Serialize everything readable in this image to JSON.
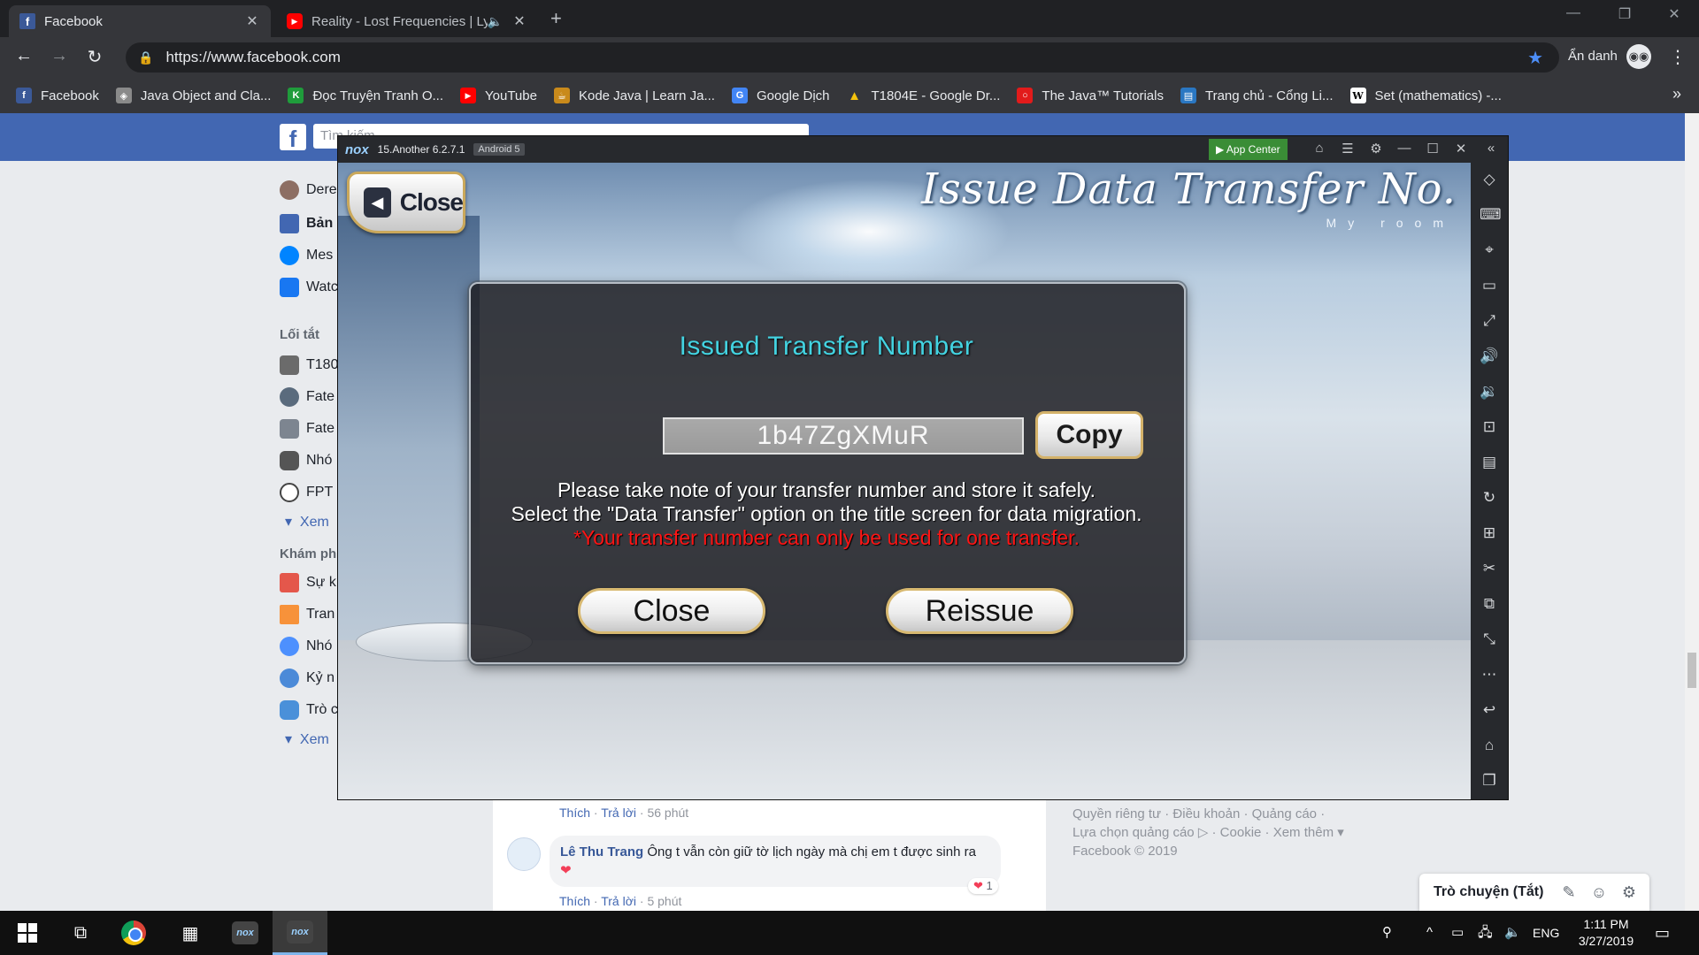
{
  "browser": {
    "tabs": [
      {
        "title": "Facebook",
        "favicon": "facebook-icon",
        "active": true
      },
      {
        "title": "Reality - Lost Frequencies | Ly",
        "favicon": "youtube-icon",
        "active": false
      }
    ],
    "new_tab_label": "+",
    "address": "https://www.facebook.com",
    "incognito_label": "Ẩn danh",
    "bookmarks": [
      {
        "label": "Facebook",
        "icon": "facebook-icon",
        "color": "#3b5998"
      },
      {
        "label": "Java Object and Cla...",
        "icon": "cube-icon",
        "color": "#8a8a8a"
      },
      {
        "label": "Đọc Truyện Tranh O...",
        "icon": "k-icon",
        "color": "#1f9c3b"
      },
      {
        "label": "YouTube",
        "icon": "youtube-icon",
        "color": "#ff0000"
      },
      {
        "label": "Kode Java | Learn Ja...",
        "icon": "coffee-icon",
        "color": "#c98a1b"
      },
      {
        "label": "Google Dịch",
        "icon": "translate-icon",
        "color": "#4285f4"
      },
      {
        "label": "T1804E - Google Dr...",
        "icon": "drive-icon",
        "color": "#0f9d58"
      },
      {
        "label": "The Java™ Tutorials",
        "icon": "oracle-icon",
        "color": "#e21b1b"
      },
      {
        "label": "Trang chủ - Cổng Li...",
        "icon": "portal-icon",
        "color": "#2a77c2"
      },
      {
        "label": "Set (mathematics) -...",
        "icon": "wikipedia-icon",
        "color": "#ffffff"
      }
    ]
  },
  "facebook": {
    "search_placeholder": "Tìm kiếm",
    "nav": [
      {
        "label": "Dere",
        "icon": "profile-avatar-icon",
        "color": "#8d6e63"
      },
      {
        "label": "Bản",
        "icon": "news-feed-icon",
        "color": "#4267b2"
      },
      {
        "label": "Mes",
        "icon": "messenger-icon",
        "color": "#0084ff"
      },
      {
        "label": "Watc",
        "icon": "watch-icon",
        "color": "#1877f2"
      }
    ],
    "shortcuts_heading": "Lối tắt",
    "shortcuts": [
      {
        "label": "T180",
        "icon": "group-icon",
        "color": "#6b6b6b"
      },
      {
        "label": "Fate",
        "icon": "shield-icon",
        "color": "#5a6b7d"
      },
      {
        "label": "Fate",
        "icon": "group-icon",
        "color": "#7d8590"
      },
      {
        "label": "Nhó",
        "icon": "gamepad-icon",
        "color": "#555"
      },
      {
        "label": "FPT",
        "icon": "skull-icon",
        "color": "#444"
      }
    ],
    "see_more_1": "Xem",
    "explore_heading": "Khám ph",
    "explore": [
      {
        "label": "Sự k",
        "icon": "calendar-icon",
        "color": "#e4574b"
      },
      {
        "label": "Tran",
        "icon": "flag-icon",
        "color": "#f7923a"
      },
      {
        "label": "Nhó",
        "icon": "groups-icon",
        "color": "#4d90fe"
      },
      {
        "label": "Kỷ n",
        "icon": "memories-icon",
        "color": "#4b8ad8"
      },
      {
        "label": "Trò c",
        "icon": "gaming-icon",
        "color": "#4a90d9"
      }
    ],
    "see_more_2": "Xem",
    "comments": {
      "meta1": {
        "like": "Thích",
        "reply": "Trả lời",
        "time": "56 phút"
      },
      "author": "Lê Thu Trang",
      "text": "Ông t vẫn còn giữ tờ lịch ngày mà chị em t được sinh ra",
      "reaction_count": "1",
      "meta2": {
        "like": "Thích",
        "reply": "Trả lời",
        "time": "5 phút"
      }
    },
    "footer": {
      "line1": "Quyền riêng tư · Điều khoản · Quảng cáo ·",
      "line2": "Lựa chọn quảng cáo ▷ · Cookie · Xem thêm ▾",
      "line3": "Facebook © 2019"
    },
    "chat_label": "Trò chuyện (Tắt)"
  },
  "nox": {
    "logo": "nox",
    "version": "15.Another 6.2.7.1",
    "android": "Android 5",
    "app_center": "App Center",
    "side_icons": [
      "tag-icon",
      "keyboard-icon",
      "location-icon",
      "screen-icon",
      "fullscreen-icon",
      "volume-up-icon",
      "volume-down-icon",
      "screenshot-icon",
      "apk-icon",
      "rotate-icon",
      "add-icon",
      "scissors-icon",
      "multi-instance-icon",
      "resize-icon",
      "more-icon",
      "back-icon",
      "home-icon",
      "recent-apps-icon"
    ]
  },
  "game": {
    "top_close": "Close",
    "screen_title": "Issue Data Transfer No.",
    "screen_subtitle": "My room",
    "dialog": {
      "title": "Issued Transfer Number",
      "transfer_number": "1b47ZgXMuR",
      "copy": "Copy",
      "message_line1": "Please take note of your transfer number and store it safely.",
      "message_line2": "Select the \"Data Transfer\" option on the title screen for data migration.",
      "warning": "*Your transfer number can only be used for one transfer.",
      "close": "Close",
      "reissue": "Reissue"
    }
  },
  "taskbar": {
    "language": "ENG",
    "time": "1:11 PM",
    "date": "3/27/2019"
  }
}
